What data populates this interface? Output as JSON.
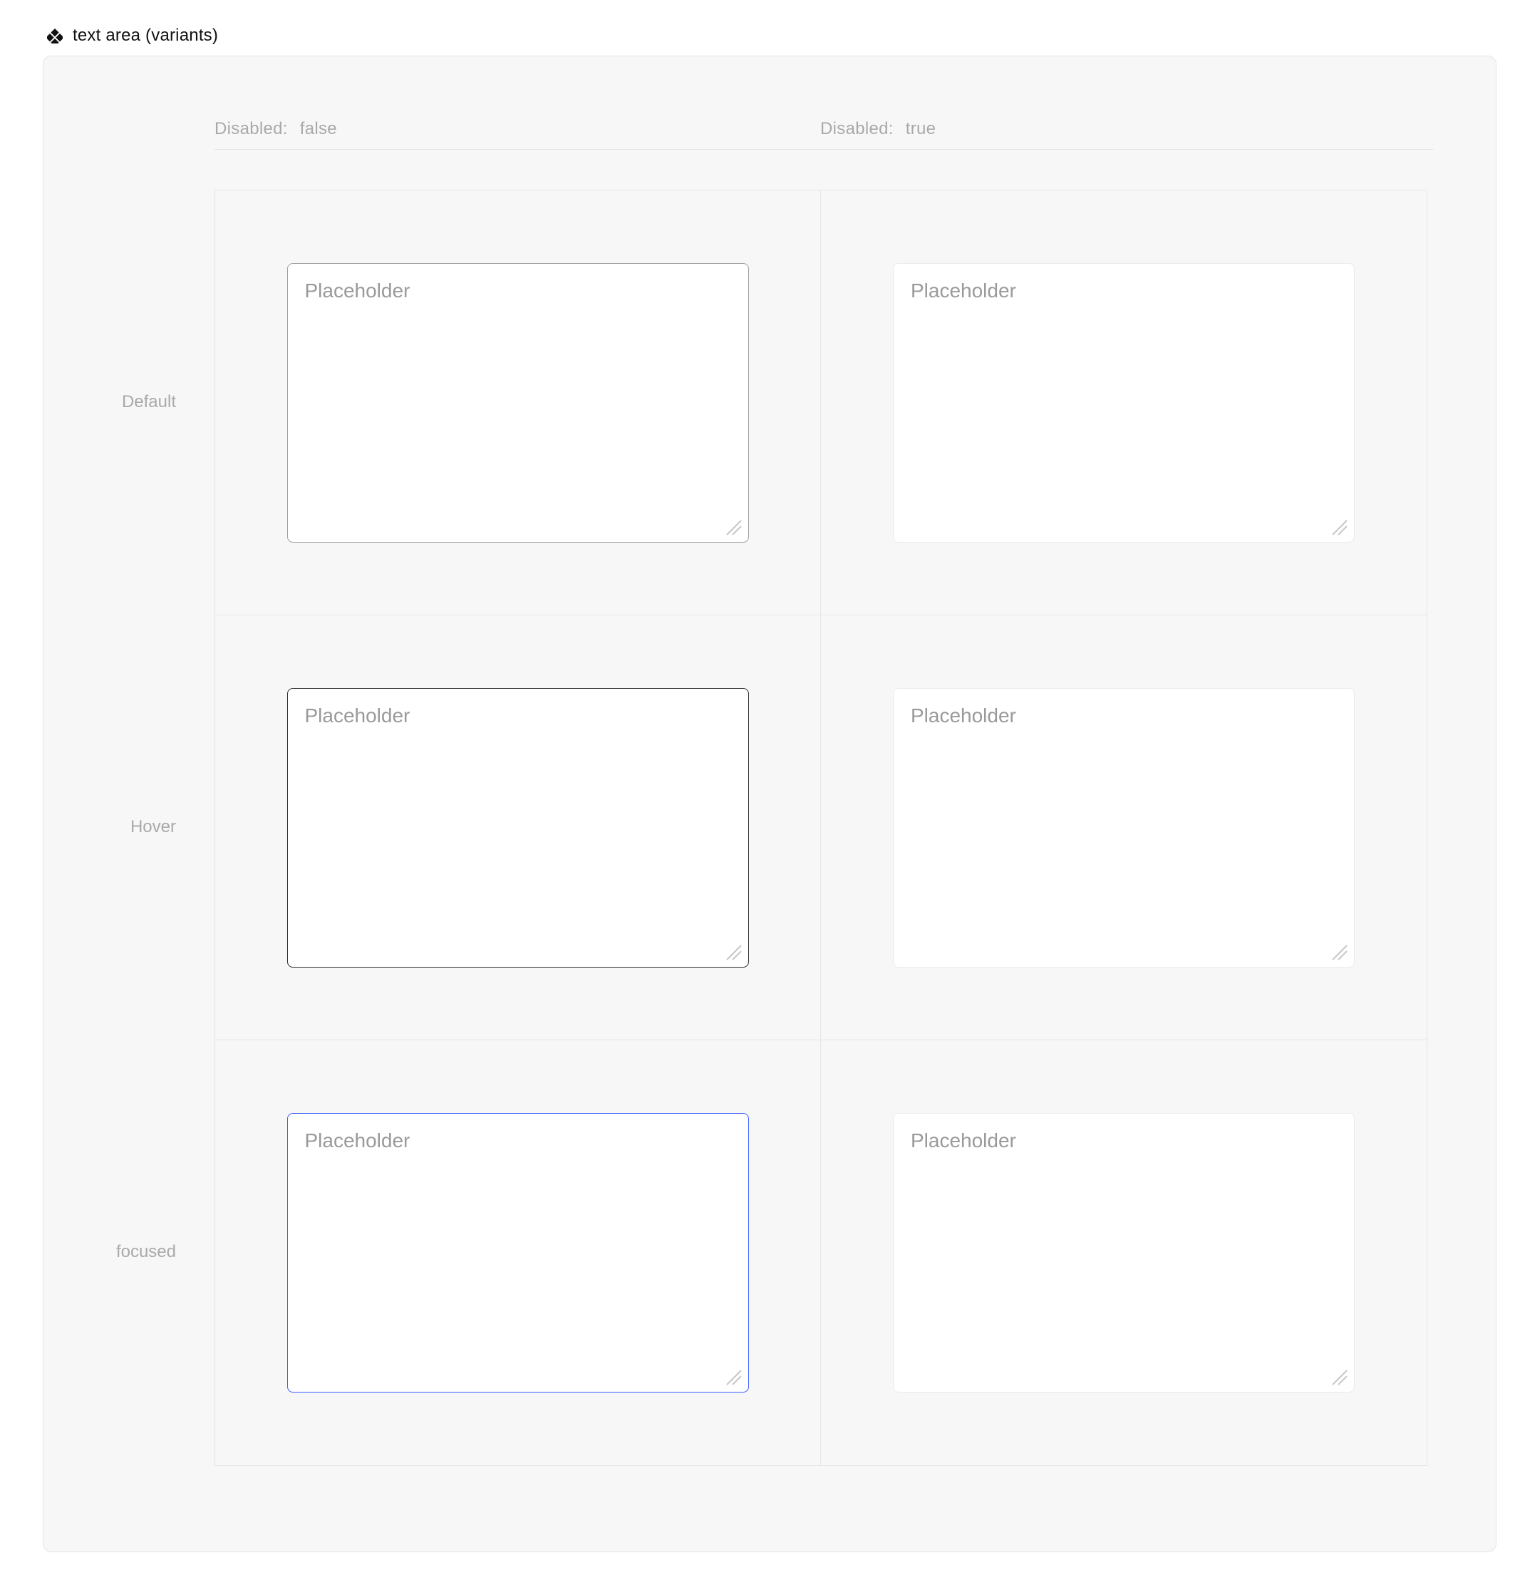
{
  "component": {
    "title": "text area (variants)"
  },
  "columns": [
    {
      "key": "Disabled:",
      "value": "false"
    },
    {
      "key": "Disabled:",
      "value": "true"
    }
  ],
  "rows": [
    {
      "label": "Default"
    },
    {
      "label": "Hover"
    },
    {
      "label": "focused"
    }
  ],
  "textarea": {
    "placeholder": "Placeholder"
  },
  "colors": {
    "focus_border": "#3b5bff",
    "hover_border": "#2b2b2b",
    "default_border": "#9e9e9e",
    "disabled_border": "#eceaea",
    "canvas_bg": "#f7f7f7",
    "muted_text": "#a9a9a9"
  },
  "cells": [
    {
      "row": "Default",
      "col": "false",
      "state": "default",
      "interactable": true
    },
    {
      "row": "Default",
      "col": "true",
      "state": "disabled",
      "interactable": false
    },
    {
      "row": "Hover",
      "col": "false",
      "state": "hover",
      "interactable": true
    },
    {
      "row": "Hover",
      "col": "true",
      "state": "disabled",
      "interactable": false
    },
    {
      "row": "focused",
      "col": "false",
      "state": "focused",
      "interactable": true
    },
    {
      "row": "focused",
      "col": "true",
      "state": "disabled",
      "interactable": false
    }
  ]
}
